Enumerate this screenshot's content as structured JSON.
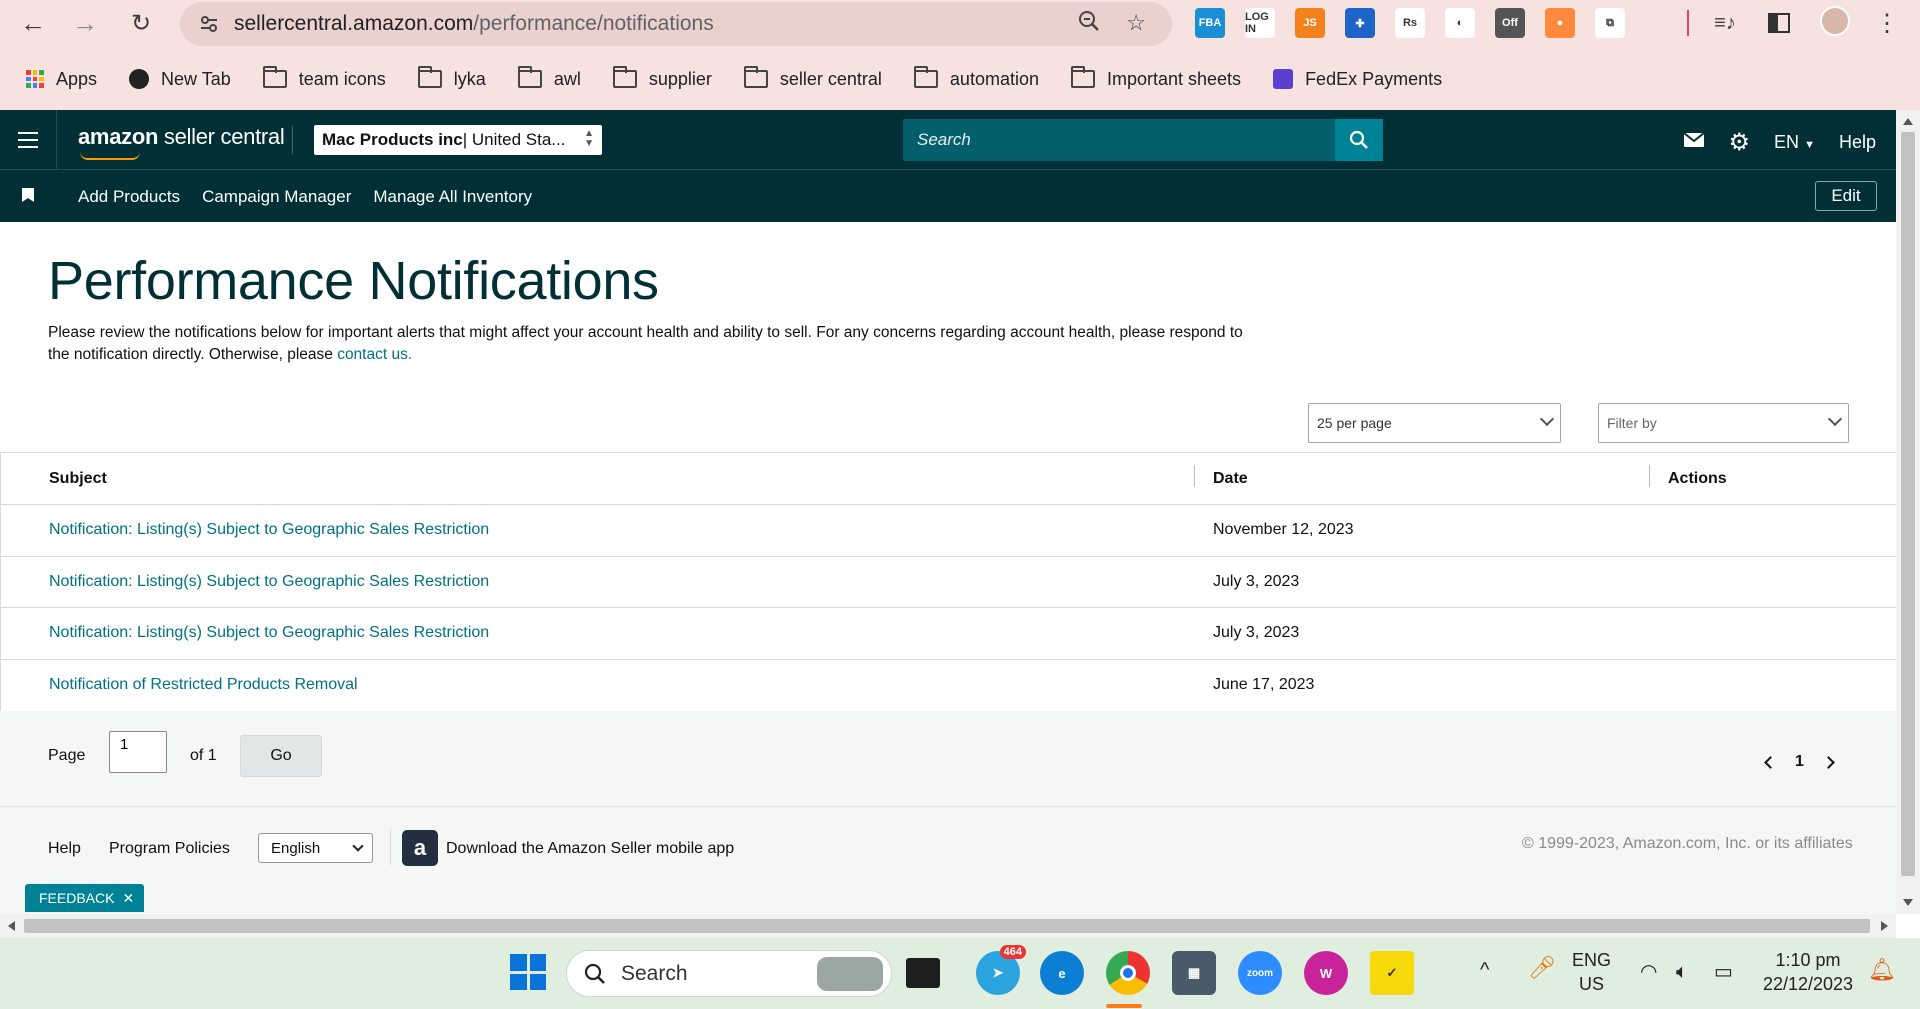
{
  "browser": {
    "url_host": "sellercentral.amazon.com",
    "url_path": "/performance/notifications",
    "extensions": [
      {
        "name": "fba-icon",
        "label": "FBA",
        "color": "#1a8fd6"
      },
      {
        "name": "login-icon",
        "label": "LOG IN",
        "color": "#ffffff"
      },
      {
        "name": "js-icon",
        "label": "JS",
        "color": "#f3821e"
      },
      {
        "name": "helium-icon",
        "label": "✚",
        "color": "#1e64c8"
      },
      {
        "name": "rs-icon",
        "label": "Rs",
        "color": "#ffffff"
      },
      {
        "name": "keepa-icon",
        "label": "◐",
        "color": "#ffffff"
      },
      {
        "name": "off-icon",
        "label": "Off",
        "color": "#555555"
      },
      {
        "name": "firefox-like-icon",
        "label": "●",
        "color": "#ff8a3d"
      },
      {
        "name": "puzzle-icon",
        "label": "⧉",
        "color": "#ffffff"
      }
    ],
    "bookmarks": [
      {
        "label": "Apps",
        "type": "apps"
      },
      {
        "label": "New Tab",
        "type": "globe"
      },
      {
        "label": "team icons",
        "type": "folder"
      },
      {
        "label": "lyka",
        "type": "folder"
      },
      {
        "label": "awl",
        "type": "folder"
      },
      {
        "label": "supplier",
        "type": "folder"
      },
      {
        "label": "seller central",
        "type": "folder"
      },
      {
        "label": "automation",
        "type": "folder"
      },
      {
        "label": "Important sheets",
        "type": "folder"
      },
      {
        "label": "FedEx Payments",
        "type": "form"
      }
    ]
  },
  "header": {
    "logo_bold": "amazon",
    "logo_rest": " seller central",
    "account_store": "Mac Products inc",
    "account_region": " | United Sta...",
    "search_placeholder": "Search",
    "lang": "EN",
    "help": "Help"
  },
  "subnav": {
    "links": [
      "Add Products",
      "Campaign Manager",
      "Manage All Inventory"
    ],
    "edit": "Edit"
  },
  "page": {
    "title": "Performance Notifications",
    "intro_text": "Please review the notifications below for important alerts that might affect your account health and ability to sell. For any concerns regarding account health, please respond to the notification directly. Otherwise, please ",
    "intro_link": "contact us.",
    "per_page": "25 per page",
    "filter_placeholder": "Filter by"
  },
  "table": {
    "headers": {
      "subject": "Subject",
      "date": "Date",
      "actions": "Actions"
    },
    "rows": [
      {
        "subject": "Notification: Listing(s) Subject to Geographic Sales Restriction",
        "date": "November 12, 2023"
      },
      {
        "subject": "Notification: Listing(s) Subject to Geographic Sales Restriction",
        "date": "July 3, 2023"
      },
      {
        "subject": "Notification: Listing(s) Subject to Geographic Sales Restriction",
        "date": "July 3, 2023"
      },
      {
        "subject": "Notification of Restricted Products Removal",
        "date": "June 17, 2023"
      }
    ]
  },
  "pager": {
    "page_label": "Page",
    "page_value": "1",
    "of_label": "of 1",
    "go": "Go",
    "current": "1"
  },
  "footer": {
    "help": "Help",
    "policies": "Program Policies",
    "language": "English",
    "app_text": "Download the Amazon Seller mobile app",
    "copyright": "© 1999-2023, Amazon.com, Inc. or its affiliates",
    "feedback": "FEEDBACK"
  },
  "taskbar": {
    "search": "Search",
    "telegram_badge": "464",
    "lang_top": "ENG",
    "lang_bottom": "US",
    "time": "1:10 pm",
    "date": "22/12/2023"
  }
}
